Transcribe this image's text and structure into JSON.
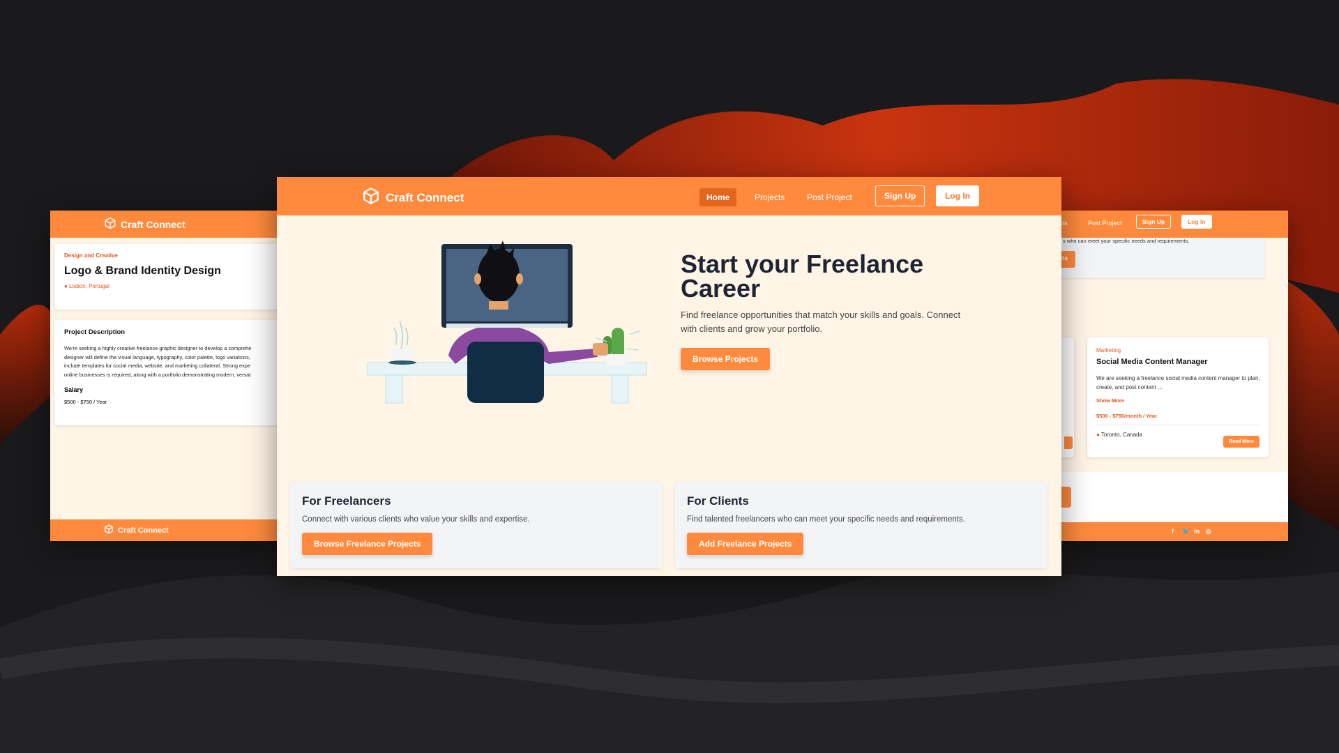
{
  "brand": "Craft Connect",
  "colors": {
    "primary": "#ff8a3d",
    "accent_text": "#e4551e",
    "dark_text": "#1d2433",
    "background": "#fff5e6"
  },
  "main": {
    "nav": {
      "home": "Home",
      "projects": "Projects",
      "post_project": "Post Project",
      "sign_up": "Sign Up",
      "log_in": "Log In"
    },
    "hero": {
      "title": "Start your Freelance Career",
      "subtitle": "Find freelance opportunities that match your skills and goals. Connect with clients and grow your portfolio.",
      "button": "Browse Projects"
    },
    "freelancers": {
      "title": "For Freelancers",
      "text": "Connect with various clients who value your skills and expertise.",
      "button": "Browse Freelance Projects"
    },
    "clients": {
      "title": "For Clients",
      "text": "Find talented freelancers who can meet your specific needs and requirements.",
      "button": "Add Freelance Projects"
    }
  },
  "left": {
    "category": "Design and Creative",
    "title": "Logo & Brand Identity Design",
    "location": "Lisbon, Portugal",
    "desc_heading": "Project Description",
    "desc_lines": [
      "We're seeking a highly creative freelance graphic designer to develop a comprehe",
      "designer will define the visual language, typography, color palette, logo variations,",
      "include templates for social media, website, and marketing collateral. Strong expe",
      "online businesses is required, along with a portfolio demonstrating modern, versat"
    ],
    "salary_label": "Salary",
    "salary_value": "$500 - $750 / Year",
    "footer_brand": "Craft Connect"
  },
  "right": {
    "nav": {
      "projects_partial": "cts",
      "post_project": "Post Project",
      "sign_up": "Sign Up",
      "log_in": "Log In"
    },
    "top_text": "s who can meet your specific needs and requirements.",
    "top_button_partial": "ects",
    "job": {
      "category": "Marketing",
      "title": "Social Media Content Manager",
      "description": "We are seeking a freelance social media content manager to plan, create, and post content ...",
      "show_more": "Show More",
      "pay": "$500 - $750/month / Year",
      "location": "Toronto, Canada",
      "read_more": "Read More"
    },
    "social": {
      "facebook": "f",
      "twitter": "🐦",
      "linkedin": "in",
      "instagram": "◎"
    }
  }
}
